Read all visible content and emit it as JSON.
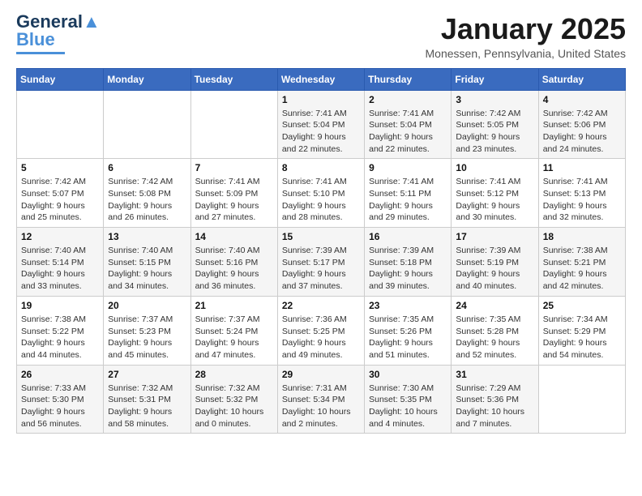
{
  "header": {
    "logo_general": "General",
    "logo_blue": "Blue",
    "month_title": "January 2025",
    "subtitle": "Monessen, Pennsylvania, United States"
  },
  "days_of_week": [
    "Sunday",
    "Monday",
    "Tuesday",
    "Wednesday",
    "Thursday",
    "Friday",
    "Saturday"
  ],
  "weeks": [
    [
      {
        "day": "",
        "info": ""
      },
      {
        "day": "",
        "info": ""
      },
      {
        "day": "",
        "info": ""
      },
      {
        "day": "1",
        "info": "Sunrise: 7:41 AM\nSunset: 5:04 PM\nDaylight: 9 hours\nand 22 minutes."
      },
      {
        "day": "2",
        "info": "Sunrise: 7:41 AM\nSunset: 5:04 PM\nDaylight: 9 hours\nand 22 minutes."
      },
      {
        "day": "3",
        "info": "Sunrise: 7:42 AM\nSunset: 5:05 PM\nDaylight: 9 hours\nand 23 minutes."
      },
      {
        "day": "4",
        "info": "Sunrise: 7:42 AM\nSunset: 5:06 PM\nDaylight: 9 hours\nand 24 minutes."
      }
    ],
    [
      {
        "day": "5",
        "info": "Sunrise: 7:42 AM\nSunset: 5:07 PM\nDaylight: 9 hours\nand 25 minutes."
      },
      {
        "day": "6",
        "info": "Sunrise: 7:42 AM\nSunset: 5:08 PM\nDaylight: 9 hours\nand 26 minutes."
      },
      {
        "day": "7",
        "info": "Sunrise: 7:41 AM\nSunset: 5:09 PM\nDaylight: 9 hours\nand 27 minutes."
      },
      {
        "day": "8",
        "info": "Sunrise: 7:41 AM\nSunset: 5:10 PM\nDaylight: 9 hours\nand 28 minutes."
      },
      {
        "day": "9",
        "info": "Sunrise: 7:41 AM\nSunset: 5:11 PM\nDaylight: 9 hours\nand 29 minutes."
      },
      {
        "day": "10",
        "info": "Sunrise: 7:41 AM\nSunset: 5:12 PM\nDaylight: 9 hours\nand 30 minutes."
      },
      {
        "day": "11",
        "info": "Sunrise: 7:41 AM\nSunset: 5:13 PM\nDaylight: 9 hours\nand 32 minutes."
      }
    ],
    [
      {
        "day": "12",
        "info": "Sunrise: 7:40 AM\nSunset: 5:14 PM\nDaylight: 9 hours\nand 33 minutes."
      },
      {
        "day": "13",
        "info": "Sunrise: 7:40 AM\nSunset: 5:15 PM\nDaylight: 9 hours\nand 34 minutes."
      },
      {
        "day": "14",
        "info": "Sunrise: 7:40 AM\nSunset: 5:16 PM\nDaylight: 9 hours\nand 36 minutes."
      },
      {
        "day": "15",
        "info": "Sunrise: 7:39 AM\nSunset: 5:17 PM\nDaylight: 9 hours\nand 37 minutes."
      },
      {
        "day": "16",
        "info": "Sunrise: 7:39 AM\nSunset: 5:18 PM\nDaylight: 9 hours\nand 39 minutes."
      },
      {
        "day": "17",
        "info": "Sunrise: 7:39 AM\nSunset: 5:19 PM\nDaylight: 9 hours\nand 40 minutes."
      },
      {
        "day": "18",
        "info": "Sunrise: 7:38 AM\nSunset: 5:21 PM\nDaylight: 9 hours\nand 42 minutes."
      }
    ],
    [
      {
        "day": "19",
        "info": "Sunrise: 7:38 AM\nSunset: 5:22 PM\nDaylight: 9 hours\nand 44 minutes."
      },
      {
        "day": "20",
        "info": "Sunrise: 7:37 AM\nSunset: 5:23 PM\nDaylight: 9 hours\nand 45 minutes."
      },
      {
        "day": "21",
        "info": "Sunrise: 7:37 AM\nSunset: 5:24 PM\nDaylight: 9 hours\nand 47 minutes."
      },
      {
        "day": "22",
        "info": "Sunrise: 7:36 AM\nSunset: 5:25 PM\nDaylight: 9 hours\nand 49 minutes."
      },
      {
        "day": "23",
        "info": "Sunrise: 7:35 AM\nSunset: 5:26 PM\nDaylight: 9 hours\nand 51 minutes."
      },
      {
        "day": "24",
        "info": "Sunrise: 7:35 AM\nSunset: 5:28 PM\nDaylight: 9 hours\nand 52 minutes."
      },
      {
        "day": "25",
        "info": "Sunrise: 7:34 AM\nSunset: 5:29 PM\nDaylight: 9 hours\nand 54 minutes."
      }
    ],
    [
      {
        "day": "26",
        "info": "Sunrise: 7:33 AM\nSunset: 5:30 PM\nDaylight: 9 hours\nand 56 minutes."
      },
      {
        "day": "27",
        "info": "Sunrise: 7:32 AM\nSunset: 5:31 PM\nDaylight: 9 hours\nand 58 minutes."
      },
      {
        "day": "28",
        "info": "Sunrise: 7:32 AM\nSunset: 5:32 PM\nDaylight: 10 hours\nand 0 minutes."
      },
      {
        "day": "29",
        "info": "Sunrise: 7:31 AM\nSunset: 5:34 PM\nDaylight: 10 hours\nand 2 minutes."
      },
      {
        "day": "30",
        "info": "Sunrise: 7:30 AM\nSunset: 5:35 PM\nDaylight: 10 hours\nand 4 minutes."
      },
      {
        "day": "31",
        "info": "Sunrise: 7:29 AM\nSunset: 5:36 PM\nDaylight: 10 hours\nand 7 minutes."
      },
      {
        "day": "",
        "info": ""
      }
    ]
  ]
}
